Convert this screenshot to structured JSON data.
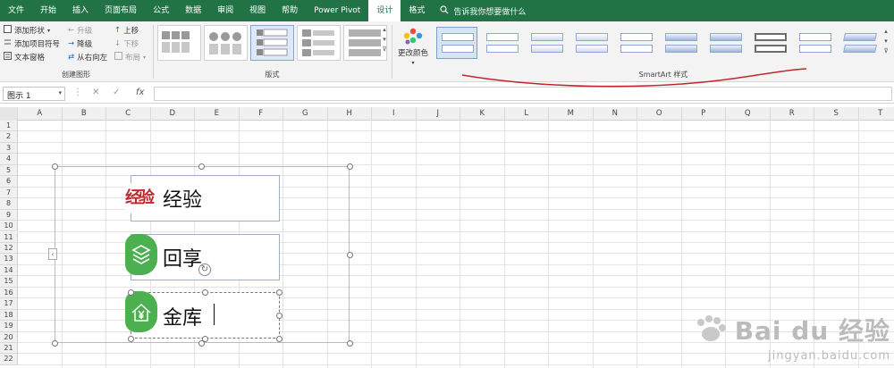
{
  "tabs": [
    "文件",
    "开始",
    "插入",
    "页面布局",
    "公式",
    "数据",
    "审阅",
    "视图",
    "帮助",
    "Power Pivot",
    "设计",
    "格式"
  ],
  "active_tab": "设计",
  "tell_me": "告诉我你想要做什么",
  "ribbon": {
    "create_group": {
      "add_shape": "添加形状",
      "add_bullet": "添加项目符号",
      "text_pane": "文本窗格",
      "promote": "升级",
      "demote": "降级",
      "right_to_left": "从右向左",
      "move_up": "上移",
      "move_down": "下移",
      "layout": "布局",
      "label": "创建图形"
    },
    "layouts_group": {
      "label": "版式"
    },
    "change_colors": "更改颜色",
    "styles_group": {
      "label": "SmartArt 样式"
    }
  },
  "formula_bar": {
    "name_box": "图示 1",
    "fx": "fx",
    "formula": ""
  },
  "columns": [
    "A",
    "B",
    "C",
    "D",
    "E",
    "F",
    "G",
    "H",
    "I",
    "J",
    "K",
    "L",
    "M",
    "N",
    "O",
    "P",
    "Q",
    "R",
    "S",
    "T"
  ],
  "rows": [
    "1",
    "2",
    "3",
    "4",
    "5",
    "6",
    "7",
    "8",
    "9",
    "10",
    "11",
    "12",
    "13",
    "14",
    "15",
    "16",
    "17",
    "18",
    "19",
    "20",
    "21",
    "22"
  ],
  "smartart": {
    "items": [
      {
        "logo": "经验",
        "text": "经验"
      },
      {
        "icon": "layers-icon",
        "text": "回享"
      },
      {
        "icon": "house-yen-icon",
        "text": "金库"
      }
    ]
  },
  "watermark": {
    "brand": "Bai du 经验",
    "url": "jingyan.baidu.com"
  },
  "colors": {
    "accent": "#217346",
    "icon_green": "#4cb050",
    "annotation": "#c0282d"
  }
}
